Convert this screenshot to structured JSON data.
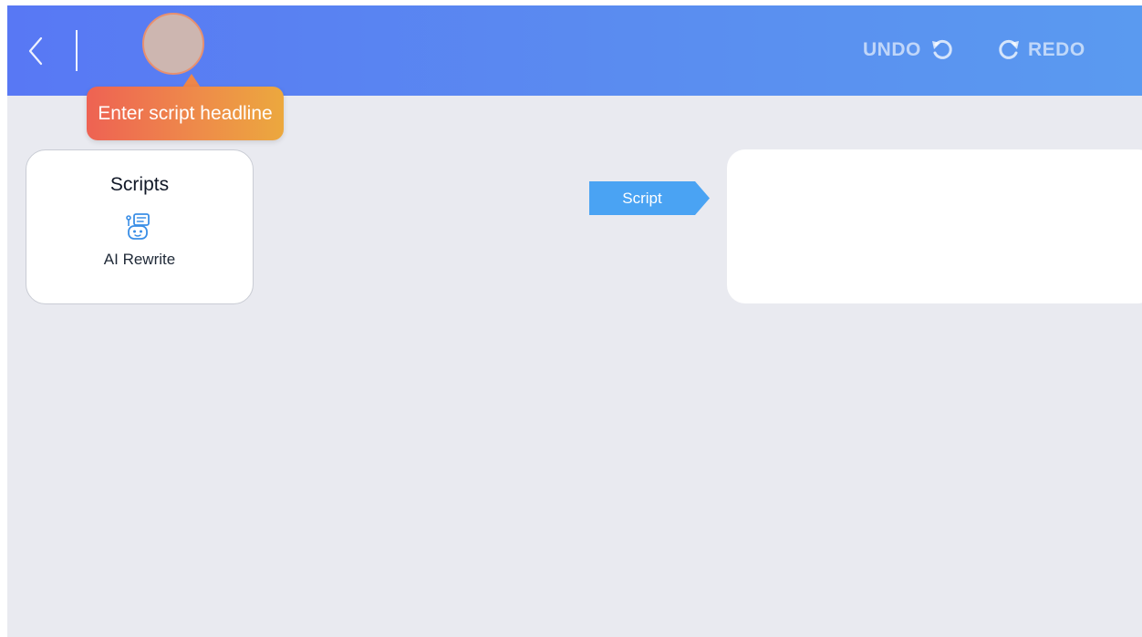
{
  "topbar": {
    "back_icon": "chevron-left-icon",
    "undo_label": "UNDO",
    "undo_icon": "undo-icon",
    "redo_label": "REDO",
    "redo_icon": "redo-icon"
  },
  "tooltip": {
    "text": "Enter script headline"
  },
  "scripts_card": {
    "title": "Scripts",
    "action_icon": "robot-chat-icon",
    "action_label": "AI Rewrite"
  },
  "script_tag": {
    "label": "Script"
  },
  "colors": {
    "topbar_start": "#5878f4",
    "topbar_end": "#5a9af0",
    "tooltip_start": "#ee6253",
    "tooltip_end": "#eca83e",
    "canvas_bg": "#e9eaf0",
    "script_tag": "#4aa3f3",
    "icon_accent": "#3a8ee6"
  }
}
